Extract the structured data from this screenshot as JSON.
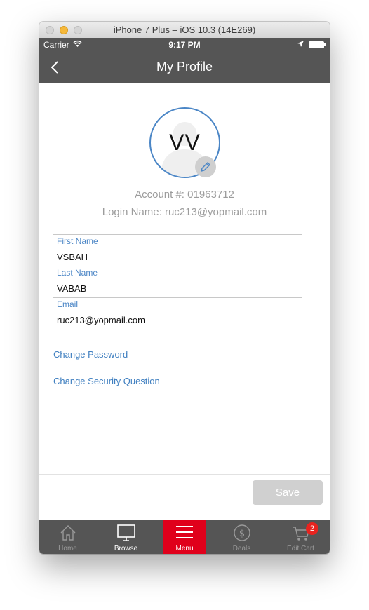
{
  "window": {
    "title": "iPhone 7 Plus – iOS 10.3 (14E269)"
  },
  "status_bar": {
    "carrier": "Carrier",
    "time": "9:17 PM"
  },
  "nav": {
    "title": "My Profile"
  },
  "profile": {
    "initials": "VV",
    "account_text": "Account #: 01963712",
    "login_text": "Login Name: ruc213@yopmail.com"
  },
  "fields": {
    "first_name": {
      "label": "First Name",
      "value": "VSBAH"
    },
    "last_name": {
      "label": "Last Name",
      "value": "VABAB"
    },
    "email": {
      "label": "Email",
      "value": "ruc213@yopmail.com"
    }
  },
  "links": {
    "change_password": "Change Password",
    "change_security_question": "Change Security Question"
  },
  "save_label": "Save",
  "tabs": [
    {
      "label": "Home",
      "icon": "home-icon"
    },
    {
      "label": "Browse",
      "icon": "monitor-icon"
    },
    {
      "label": "Menu",
      "icon": "hamburger-icon"
    },
    {
      "label": "Deals",
      "icon": "dollar-icon"
    },
    {
      "label": "Edit Cart",
      "icon": "cart-icon"
    }
  ],
  "cart_badge_count": "2",
  "colors": {
    "bar": "#555555",
    "accent_blue": "#4b86c6",
    "menu_red": "#e0001b",
    "badge_red": "#e8231f"
  }
}
